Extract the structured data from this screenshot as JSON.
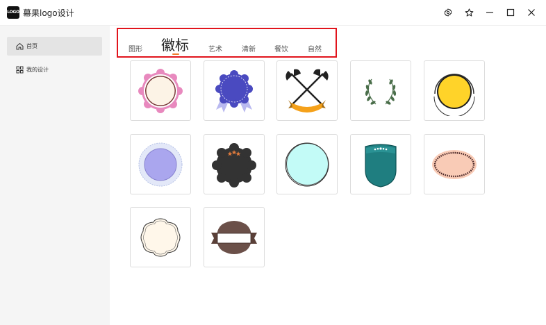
{
  "app": {
    "logo_text": "LOGO",
    "title": "幕果logo设计"
  },
  "window_controls": [
    "settings-icon",
    "star-icon",
    "minimize-icon",
    "maximize-icon",
    "close-icon"
  ],
  "sidebar": {
    "items": [
      {
        "label": "首页",
        "icon": "home-icon",
        "active": true
      },
      {
        "label": "我的设计",
        "icon": "grid-icon",
        "active": false
      }
    ]
  },
  "tabs": [
    {
      "label": "图形",
      "active": false
    },
    {
      "label": "徽标",
      "active": true
    },
    {
      "label": "艺术",
      "active": false
    },
    {
      "label": "清新",
      "active": false
    },
    {
      "label": "餐饮",
      "active": false
    },
    {
      "label": "自然",
      "active": false
    }
  ],
  "templates": [
    {
      "name": "pink-scalloped-badge"
    },
    {
      "name": "blue-rosette-ribbon-badge"
    },
    {
      "name": "crossed-axes-banner-badge"
    },
    {
      "name": "laurel-wreath-badge"
    },
    {
      "name": "yellow-circle-badge"
    },
    {
      "name": "lavender-circle-badge"
    },
    {
      "name": "dark-scalloped-stars-badge"
    },
    {
      "name": "mint-sketch-circle-badge"
    },
    {
      "name": "teal-shield-stars-badge"
    },
    {
      "name": "peach-oval-beaded-badge"
    },
    {
      "name": "cream-ornate-frame-badge"
    },
    {
      "name": "brown-ribbon-banner-badge"
    }
  ],
  "colors": {
    "accent_underline": "#f07c2c",
    "highlight_box": "#e1141c",
    "sidebar_bg": "#f5f5f5"
  }
}
